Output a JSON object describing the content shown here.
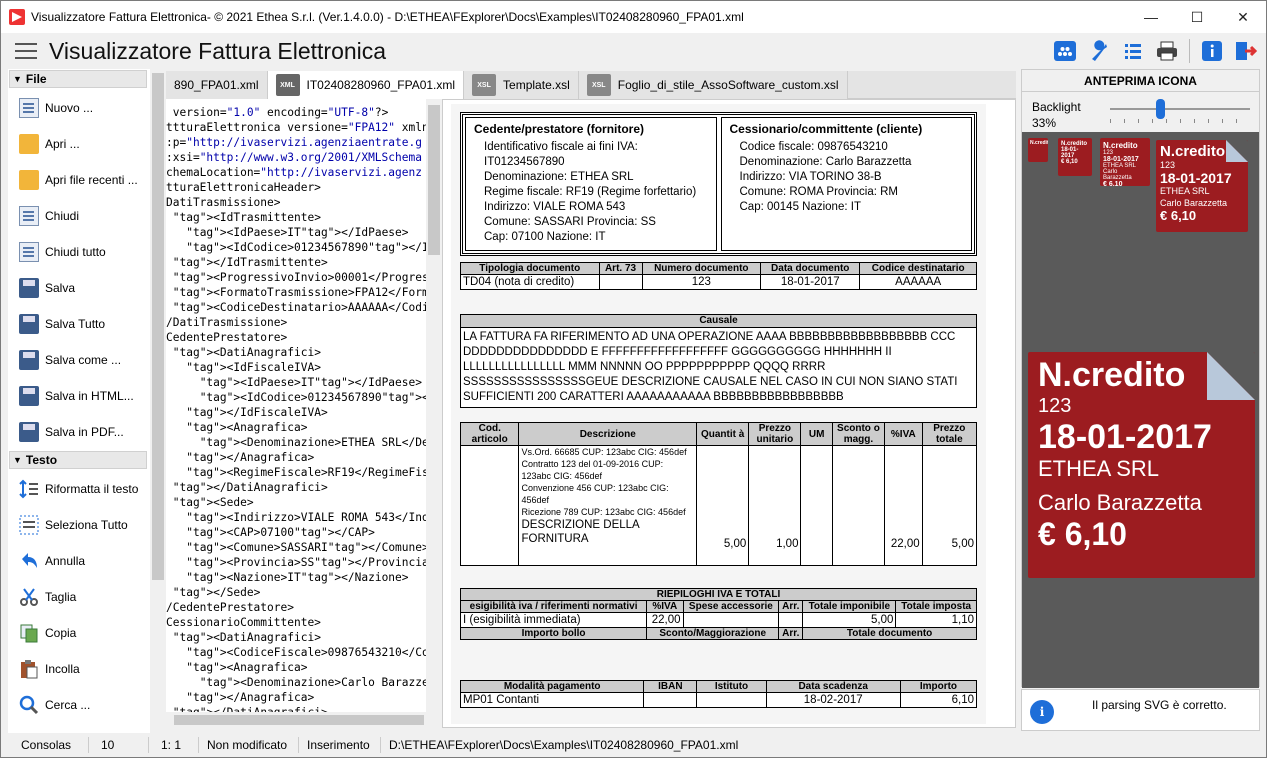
{
  "window": {
    "title": "Visualizzatore Fattura Elettronica- © 2021 Ethea S.r.l. (Ver.1.4.0.0) - D:\\ETHEA\\FExplorer\\Docs\\Examples\\IT02408280960_FPA01.xml",
    "minimize": "—",
    "maximize": "☐",
    "close": "✕"
  },
  "header": {
    "title": "Visualizzatore Fattura Elettronica"
  },
  "toolbar_icons": [
    "viewer-icon",
    "wrench-icon",
    "list-icon",
    "printer-icon",
    "info-icon",
    "exit-icon"
  ],
  "sidebar": {
    "file_group": "File",
    "file_items": [
      "Nuovo ...",
      "Apri ...",
      "Apri file recenti ...",
      "Chiudi",
      "Chiudi tutto",
      "Salva",
      "Salva Tutto",
      "Salva come ...",
      "Salva in HTML...",
      "Salva in PDF..."
    ],
    "text_group": "Testo",
    "text_items": [
      "Riformatta il testo",
      "Seleziona Tutto",
      "Annulla",
      "Taglia",
      "Copia",
      "Incolla",
      "Cerca ..."
    ]
  },
  "tabs": [
    {
      "label": "890_FPA01.xml",
      "icon": ""
    },
    {
      "label": "IT02408280960_FPA01.xml",
      "icon": "XML"
    },
    {
      "label": "Template.xsl",
      "icon": "XSL"
    },
    {
      "label": "Foglio_di_stile_AssoSoftware_custom.xsl",
      "icon": "XSL"
    }
  ],
  "xml_lines": [
    " version=\"1.0\" encoding=\"UTF-8\"?>",
    "ttturaElettronica versione=\"FPA12\" xmln",
    ":p=\"http://ivaservizi.agenziaentrate.g",
    ":xsi=\"http://www.w3.org/2001/XMLSchema",
    "chemaLocation=\"http://ivaservizi.agenz",
    "tturaElettronicaHeader>",
    "DatiTrasmissione>",
    " <IdTrasmittente>",
    "   <IdPaese>IT</IdPaese>",
    "   <IdCodice>01234567890</IdCodice>",
    " </IdTrasmittente>",
    " <ProgressivoInvio>00001</ProgressivoI",
    " <FormatoTrasmissione>FPA12</FormatoTr",
    " <CodiceDestinatario>AAAAAA</CodiceDes",
    "/DatiTrasmissione>",
    "CedentePrestatore>",
    " <DatiAnagrafici>",
    "   <IdFiscaleIVA>",
    "     <IdPaese>IT</IdPaese>",
    "     <IdCodice>01234567890</IdCodice>",
    "   </IdFiscaleIVA>",
    "   <Anagrafica>",
    "     <Denominazione>ETHEA SRL</Denomi",
    "   </Anagrafica>",
    "   <RegimeFiscale>RF19</RegimeFiscale",
    " </DatiAnagrafici>",
    " <Sede>",
    "   <Indirizzo>VIALE ROMA 543</Indirizz",
    "   <CAP>07100</CAP>",
    "   <Comune>SASSARI</Comune>",
    "   <Provincia>SS</Provincia>",
    "   <Nazione>IT</Nazione>",
    " </Sede>",
    "/CedentePrestatore>",
    "CessionarioCommittente>",
    " <DatiAnagrafici>",
    "   <CodiceFiscale>09876543210</CodiceF",
    "   <Anagrafica>",
    "     <Denominazione>Carlo Barazzetta<",
    "   </Anagrafica>",
    " </DatiAnagrafici>"
  ],
  "invoice": {
    "cedente": {
      "heading": "Cedente/prestatore (fornitore)",
      "lines": [
        "Identificativo fiscale ai fini IVA:",
        "IT01234567890",
        "Denominazione: ETHEA SRL",
        "Regime fiscale: RF19 (Regime forfettario)",
        "Indirizzo: VIALE ROMA 543",
        "Comune: SASSARI Provincia: SS",
        "Cap: 07100 Nazione: IT"
      ]
    },
    "cessionario": {
      "heading": "Cessionario/committente (cliente)",
      "lines": [
        "Codice fiscale: 09876543210",
        "Denominazione: Carlo Barazzetta",
        "Indirizzo: VIA TORINO 38-B",
        "Comune: ROMA Provincia: RM",
        "Cap: 00145 Nazione: IT"
      ]
    },
    "doc_headers": [
      "Tipologia documento",
      "Art. 73",
      "Numero documento",
      "Data documento",
      "Codice destinatario"
    ],
    "doc_values": [
      "TD04 (nota di credito)",
      "",
      "123",
      "18-01-2017",
      "AAAAAA"
    ],
    "causale_heading": "Causale",
    "causale_text": "LA FATTURA FA RIFERIMENTO AD UNA OPERAZIONE AAAA BBBBBBBBBBBBBBBBBB CCC DDDDDDDDDDDDDDD E FFFFFFFFFFFFFFFFFF GGGGGGGGGG HHHHHHH II LLLLLLLLLLLLLLLL MMM NNNNN OO PPPPPPPPPPP QQQQ RRRR SSSSSSSSSSSSSSSSGEUE DESCRIZIONE CAUSALE NEL CASO IN CUI NON SIANO STATI SUFFICIENTI 200 CARATTERI AAAAAAAAAAA BBBBBBBBBBBBBBBBB",
    "lines_headers": [
      "Cod. articolo",
      "Descrizione",
      "Quantit à",
      "Prezzo unitario",
      "UM",
      "Sconto o magg.",
      "%IVA",
      "Prezzo totale"
    ],
    "line_refs": [
      "Vs.Ord. 66685 CUP: 123abc CIG: 456def",
      "Contratto 123 del 01-09-2016 CUP: 123abc CIG: 456def",
      "Convenzione 456 CUP: 123abc CIG: 456def",
      "Ricezione 789 CUP: 123abc CIG: 456def"
    ],
    "line_desc": "DESCRIZIONE DELLA FORNITURA",
    "line_qty": "5,00",
    "line_price": "1,00",
    "line_um": "",
    "line_disc": "",
    "line_vat": "22,00",
    "line_total": "5,00",
    "riep_title": "RIEPILOGHI IVA E TOTALI",
    "riep_headers": [
      "esigibilità iva / riferimenti normativi",
      "%IVA",
      "Spese accessorie",
      "Arr.",
      "Totale imponibile",
      "Totale imposta"
    ],
    "riep_values": [
      "I (esigibilità immediata)",
      "22,00",
      "",
      "",
      "5,00",
      "1,10"
    ],
    "riep_headers2": [
      "Importo bollo",
      "Sconto/Maggiorazione",
      "Arr.",
      "Totale documento"
    ],
    "pay_headers": [
      "Modalità pagamento",
      "IBAN",
      "Istituto",
      "Data scadenza",
      "Importo"
    ],
    "pay_values": [
      "MP01 Contanti",
      "",
      "",
      "18-02-2017",
      "6,10"
    ]
  },
  "icon_preview": {
    "title": "ANTEPRIMA ICONA",
    "backlight_label": "Backlight",
    "backlight_value": "33%",
    "backlight_level": 0.33,
    "card_title": "N.credito",
    "card_number": "123",
    "card_date": "18-01-2017",
    "card_from": "ETHEA SRL",
    "card_to": "Carlo Barazzetta",
    "card_amount": "€ 6,10",
    "card_color": "#9c1c20",
    "parse_message": "Il parsing SVG è corretto."
  },
  "status": {
    "consoles": "Consolas",
    "font_size": "10",
    "position": "1:  1",
    "modified": "Non modificato",
    "mode": "Inserimento",
    "path": "D:\\ETHEA\\FExplorer\\Docs\\Examples\\IT02408280960_FPA01.xml"
  }
}
